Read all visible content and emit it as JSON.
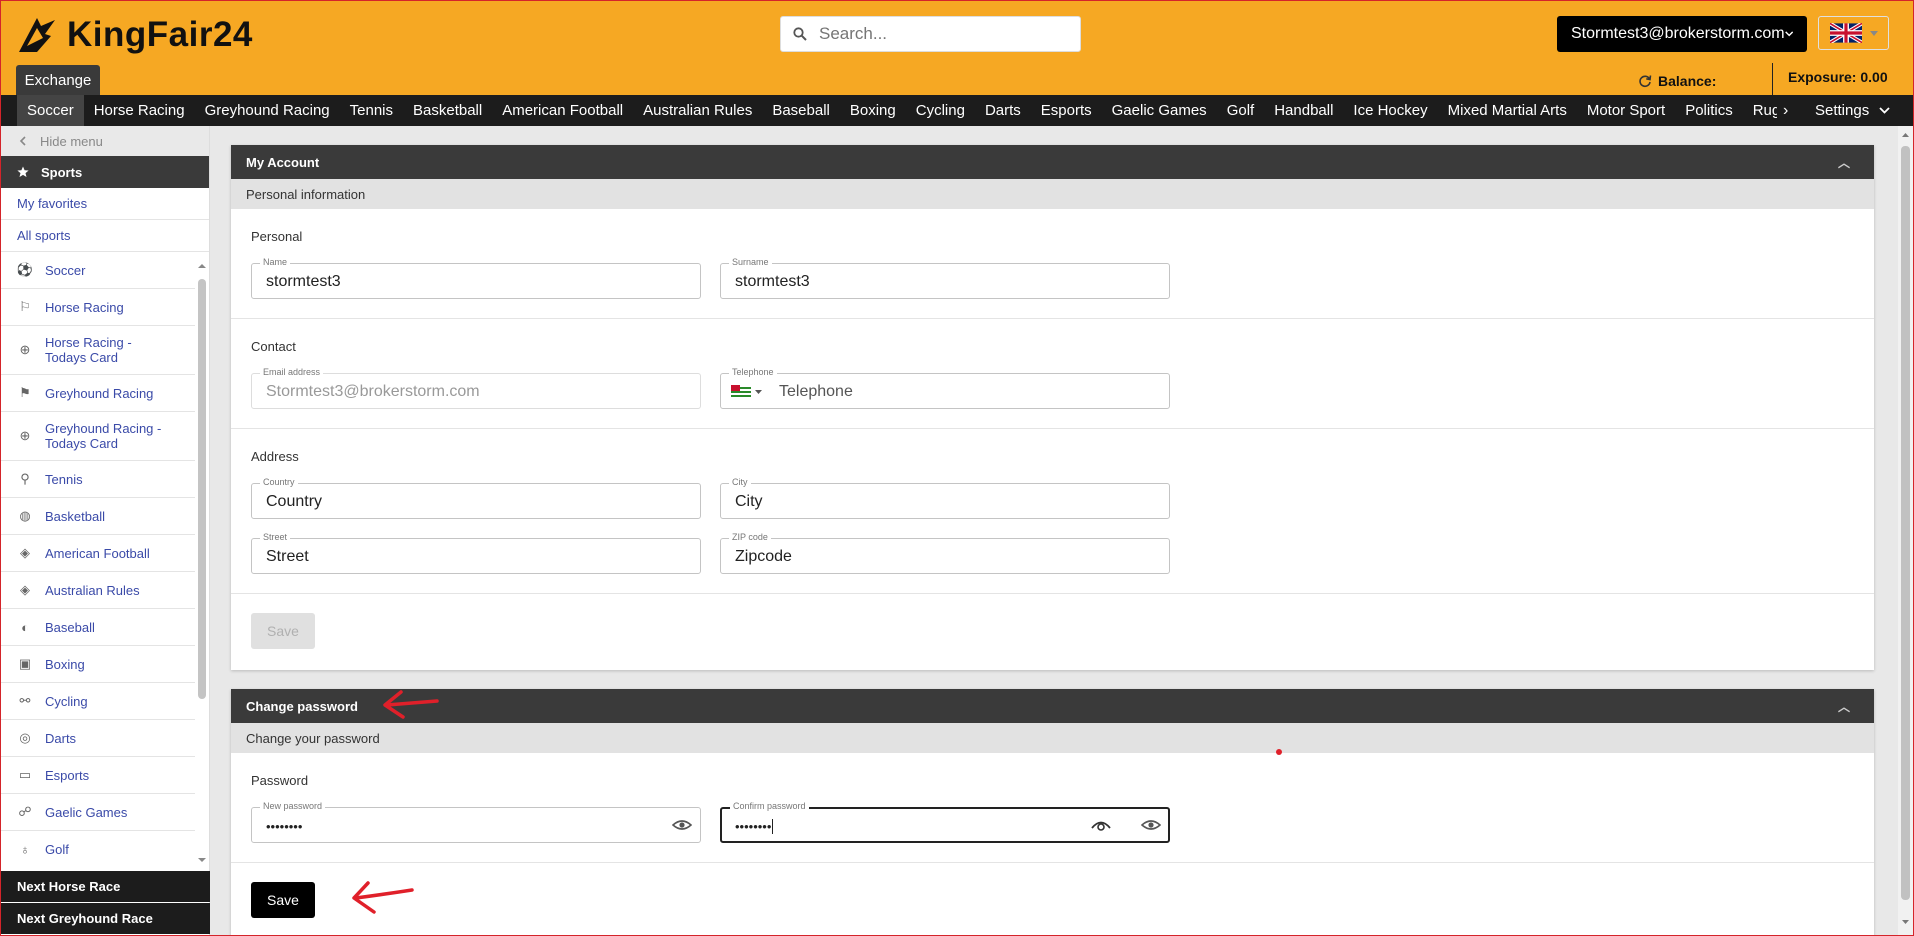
{
  "header": {
    "logo_text": "KingFair24",
    "search_placeholder": "Search...",
    "user_email": "Stormtest3@brokerstorm.com",
    "exchange_tab": "Exchange",
    "balance_label": "Balance:",
    "exposure_label": "Exposure: 0.00"
  },
  "sports_nav": {
    "items": [
      "Soccer",
      "Horse Racing",
      "Greyhound Racing",
      "Tennis",
      "Basketball",
      "American Football",
      "Australian Rules",
      "Baseball",
      "Boxing",
      "Cycling",
      "Darts",
      "Esports",
      "Gaelic Games",
      "Golf",
      "Handball",
      "Ice Hockey",
      "Mixed Martial Arts",
      "Motor Sport",
      "Politics",
      "Rugby"
    ],
    "active": "Soccer",
    "settings_label": "Settings"
  },
  "sidebar": {
    "hide_menu": "Hide menu",
    "sports_heading": "Sports",
    "my_favorites": "My favorites",
    "all_sports": "All sports",
    "items": [
      {
        "label": "Soccer",
        "icon": "soccer-ball-icon"
      },
      {
        "label": "Horse Racing",
        "icon": "flag-icon"
      },
      {
        "label": "Horse Racing - Todays Card",
        "icon": "plus-circle-icon"
      },
      {
        "label": "Greyhound Racing",
        "icon": "flag-filled-icon"
      },
      {
        "label": "Greyhound Racing - Todays Card",
        "icon": "plus-circle-icon"
      },
      {
        "label": "Tennis",
        "icon": "tennis-racket-icon"
      },
      {
        "label": "Basketball",
        "icon": "basketball-icon"
      },
      {
        "label": "American Football",
        "icon": "football-icon"
      },
      {
        "label": "Australian Rules",
        "icon": "football-icon"
      },
      {
        "label": "Baseball",
        "icon": "baseball-icon"
      },
      {
        "label": "Boxing",
        "icon": "boxing-glove-icon"
      },
      {
        "label": "Cycling",
        "icon": "bicycle-icon"
      },
      {
        "label": "Darts",
        "icon": "target-icon"
      },
      {
        "label": "Esports",
        "icon": "gamepad-icon"
      },
      {
        "label": "Gaelic Games",
        "icon": "player-icon"
      },
      {
        "label": "Golf",
        "icon": "golf-icon"
      }
    ],
    "next_horse_race": "Next Horse Race",
    "next_greyhound_race": "Next Greyhound Race"
  },
  "account": {
    "title": "My Account",
    "subtitle": "Personal information",
    "personal_title": "Personal",
    "name_label": "Name",
    "name_value": "stormtest3",
    "surname_label": "Surname",
    "surname_value": "stormtest3",
    "contact_title": "Contact",
    "email_label": "Email address",
    "email_value": "Stormtest3@brokerstorm.com",
    "telephone_label": "Telephone",
    "telephone_placeholder": "Telephone",
    "address_title": "Address",
    "country_label": "Country",
    "country_placeholder": "Country",
    "city_label": "City",
    "city_placeholder": "City",
    "street_label": "Street",
    "street_placeholder": "Street",
    "zip_label": "ZIP code",
    "zip_placeholder": "Zipcode",
    "save_label": "Save"
  },
  "password": {
    "title": "Change password",
    "subtitle": "Change your password",
    "section_title": "Password",
    "new_label": "New password",
    "new_value": "••••••••",
    "confirm_label": "Confirm password",
    "confirm_value": "••••••••",
    "save_label": "Save"
  },
  "colors": {
    "brand": "#f6a823",
    "dark": "#1c1c1c",
    "panel_head": "#3a3a3a",
    "annotation_arrow": "#e0202a"
  }
}
